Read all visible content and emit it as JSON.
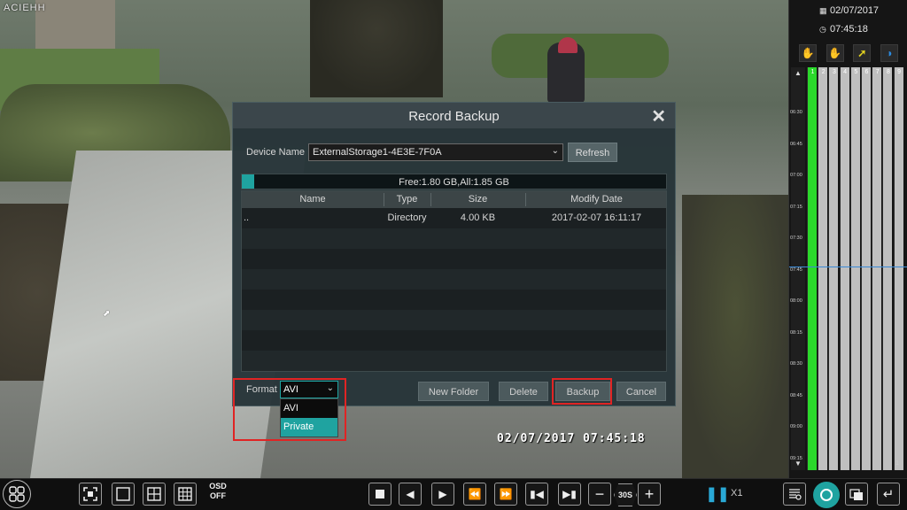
{
  "camera": {
    "label": "ACIEHH",
    "timestamp": "02/07/2017  07:45:18"
  },
  "timeline": {
    "date": "02/07/2017",
    "time": "07:45:18",
    "channels": [
      "1",
      "2",
      "3",
      "4",
      "5",
      "6",
      "7",
      "8",
      "9"
    ],
    "recording_channels": [
      "1"
    ],
    "ticks": [
      "06:30",
      "06:45",
      "07:00",
      "07:15",
      "07:30",
      "07:45",
      "08:00",
      "08:15",
      "08:30",
      "08:45",
      "09:00",
      "09:15"
    ],
    "footer": "1",
    "icons": [
      "motion-hand-icon",
      "sensor-hand-icon",
      "running-man-icon",
      "all-channels-icon"
    ],
    "colors": {
      "recording": "#2bd92b",
      "cursor": "#3b8bd9"
    }
  },
  "modal": {
    "title": "Record Backup",
    "device_label": "Device Name",
    "device_value": "ExternalStorage1-4E3E-7F0A",
    "refresh_label": "Refresh",
    "storage_text": "Free:1.80 GB,All:1.85 GB",
    "storage_free_ratio": 0.03,
    "columns": [
      "Name",
      "Type",
      "Size",
      "Modify Date"
    ],
    "rows": [
      {
        "name": "..",
        "type": "Directory",
        "size": "4.00 KB",
        "date": "2017-02-07 16:11:17"
      }
    ],
    "format_label": "Format",
    "format_value": "AVI",
    "format_options": [
      "AVI",
      "Private"
    ],
    "format_highlighted": "Private",
    "new_folder_label": "New Folder",
    "delete_label": "Delete",
    "backup_label": "Backup",
    "cancel_label": "Cancel"
  },
  "toolbar": {
    "osd_label_1": "OSD",
    "osd_label_2": "OFF",
    "interval_label": "30S",
    "speed_label": "X1"
  }
}
